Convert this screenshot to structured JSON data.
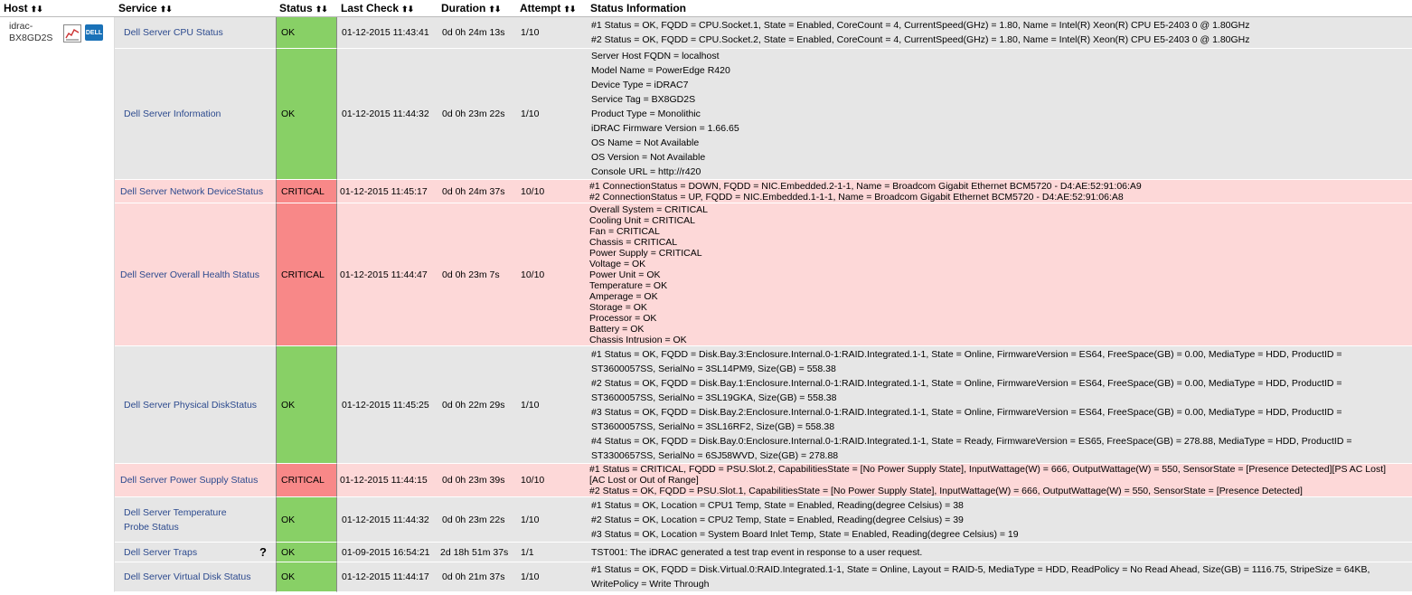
{
  "headers": {
    "host": "Host",
    "service": "Service",
    "status": "Status",
    "last_check": "Last Check",
    "duration": "Duration",
    "attempt": "Attempt",
    "status_info": "Status Information"
  },
  "sort_glyph": "⬆⬇",
  "host": {
    "name_line1": "idrac-",
    "name_line2": "BX8GD2S",
    "dell_icon_text": "DELL"
  },
  "colors": {
    "ok": "#88d066",
    "critical": "#f88888",
    "ok_row": "#e6e6e6",
    "critical_row": "#fdd8d8"
  },
  "services": [
    {
      "name": "Dell Server CPU Status",
      "status": "OK",
      "last_check": "01-12-2015 11:43:41",
      "duration": "0d 0h 24m 13s",
      "attempt": "1/10",
      "info": [
        "#1 Status = OK, FQDD = CPU.Socket.1, State = Enabled, CoreCount = 4, CurrentSpeed(GHz) = 1.80, Name = Intel(R) Xeon(R) CPU E5-2403 0 @ 1.80GHz",
        "#2 Status = OK, FQDD = CPU.Socket.2, State = Enabled, CoreCount = 4, CurrentSpeed(GHz) = 1.80, Name = Intel(R) Xeon(R) CPU E5-2403 0 @ 1.80GHz"
      ]
    },
    {
      "name": "Dell Server Information",
      "status": "OK",
      "last_check": "01-12-2015 11:44:32",
      "duration": "0d 0h 23m 22s",
      "attempt": "1/10",
      "info": [
        "Server Host FQDN = localhost",
        "Model Name = PowerEdge R420",
        "Device Type = iDRAC7",
        "Service Tag = BX8GD2S",
        "Product Type = Monolithic",
        "iDRAC Firmware Version = 1.66.65",
        "OS Name = Not Available",
        "OS Version = Not Available",
        "Console URL = http://r420"
      ]
    },
    {
      "name_line1": "Dell Server Network Device",
      "name_line2": "Status",
      "status": "CRITICAL",
      "last_check": "01-12-2015 11:45:17",
      "duration": "0d 0h 24m 37s",
      "attempt": "10/10",
      "info": [
        "#1 ConnectionStatus = DOWN, FQDD = NIC.Embedded.2-1-1, Name = Broadcom Gigabit Ethernet BCM5720 - D4:AE:52:91:06:A9",
        "#2 ConnectionStatus = UP, FQDD = NIC.Embedded.1-1-1, Name = Broadcom Gigabit Ethernet BCM5720 - D4:AE:52:91:06:A8"
      ]
    },
    {
      "name": "Dell Server Overall Health Status",
      "status": "CRITICAL",
      "last_check": "01-12-2015 11:44:47",
      "duration": "0d 0h 23m 7s",
      "attempt": "10/10",
      "info": [
        "Overall System = CRITICAL",
        "Cooling Unit = CRITICAL",
        "Fan = CRITICAL",
        "Chassis = CRITICAL",
        "Power Supply = CRITICAL",
        "Voltage = OK",
        "Power Unit = OK",
        "Temperature = OK",
        "Amperage = OK",
        "Storage = OK",
        "Processor = OK",
        "Battery = OK",
        "Chassis Intrusion = OK"
      ]
    },
    {
      "name_line1": "Dell Server Physical Disk",
      "name_line2": "Status",
      "status": "OK",
      "last_check": "01-12-2015 11:45:25",
      "duration": "0d 0h 22m 29s",
      "attempt": "1/10",
      "info": [
        "#1 Status = OK, FQDD = Disk.Bay.3:Enclosure.Internal.0-1:RAID.Integrated.1-1, State = Online, FirmwareVersion = ES64, FreeSpace(GB) = 0.00, MediaType = HDD, ProductID =",
        "ST3600057SS, SerialNo = 3SL14PM9, Size(GB) = 558.38",
        "#2 Status = OK, FQDD = Disk.Bay.1:Enclosure.Internal.0-1:RAID.Integrated.1-1, State = Online, FirmwareVersion = ES64, FreeSpace(GB) = 0.00, MediaType = HDD, ProductID =",
        "ST3600057SS, SerialNo = 3SL19GKA, Size(GB) = 558.38",
        "#3 Status = OK, FQDD = Disk.Bay.2:Enclosure.Internal.0-1:RAID.Integrated.1-1, State = Online, FirmwareVersion = ES64, FreeSpace(GB) = 0.00, MediaType = HDD, ProductID =",
        "ST3600057SS, SerialNo = 3SL16RF2, Size(GB) = 558.38",
        "#4 Status = OK, FQDD = Disk.Bay.0:Enclosure.Internal.0-1:RAID.Integrated.1-1, State = Ready, FirmwareVersion = ES65, FreeSpace(GB) = 278.88, MediaType = HDD, ProductID =",
        "ST3300657SS, SerialNo = 6SJ58WVD, Size(GB) = 278.88"
      ]
    },
    {
      "name": "Dell Server Power Supply Status",
      "status": "CRITICAL",
      "last_check": "01-12-2015 11:44:15",
      "duration": "0d 0h 23m 39s",
      "attempt": "10/10",
      "info": [
        "#1 Status = CRITICAL, FQDD = PSU.Slot.2, CapabilitiesState = [No Power Supply State], InputWattage(W) = 666, OutputWattage(W) = 550, SensorState = [Presence Detected][PS AC Lost]",
        "[AC Lost or Out of Range]",
        "#2 Status = OK, FQDD = PSU.Slot.1, CapabilitiesState = [No Power Supply State], InputWattage(W) = 666, OutputWattage(W) = 550, SensorState = [Presence Detected]"
      ]
    },
    {
      "name_line1": "Dell Server Temperature",
      "name_line2": "Probe Status",
      "status": "OK",
      "last_check": "01-12-2015 11:44:32",
      "duration": "0d 0h 23m 22s",
      "attempt": "1/10",
      "info": [
        "#1 Status = OK, Location = CPU1 Temp, State = Enabled, Reading(degree Celsius) = 38",
        "#2 Status = OK, Location = CPU2 Temp, State = Enabled, Reading(degree Celsius) = 39",
        "#3 Status = OK, Location = System Board Inlet Temp, State = Enabled, Reading(degree Celsius) = 19"
      ]
    },
    {
      "name": "Dell Server Traps",
      "status": "OK",
      "last_check": "01-09-2015 16:54:21",
      "duration": "2d 18h 51m 37s",
      "attempt": "1/1",
      "info": [
        "TST001: The iDRAC generated a test trap event in response to a user request."
      ]
    },
    {
      "name": "Dell Server Virtual Disk Status",
      "status": "OK",
      "last_check": "01-12-2015 11:44:17",
      "duration": "0d 0h 21m 37s",
      "attempt": "1/10",
      "info": [
        "#1 Status = OK, FQDD = Disk.Virtual.0:RAID.Integrated.1-1, State = Online, Layout = RAID-5, MediaType = HDD, ReadPolicy = No Read Ahead, Size(GB) = 1116.75, StripeSize = 64KB,",
        "WritePolicy = Write Through"
      ]
    }
  ],
  "traps_help_glyph": "?"
}
